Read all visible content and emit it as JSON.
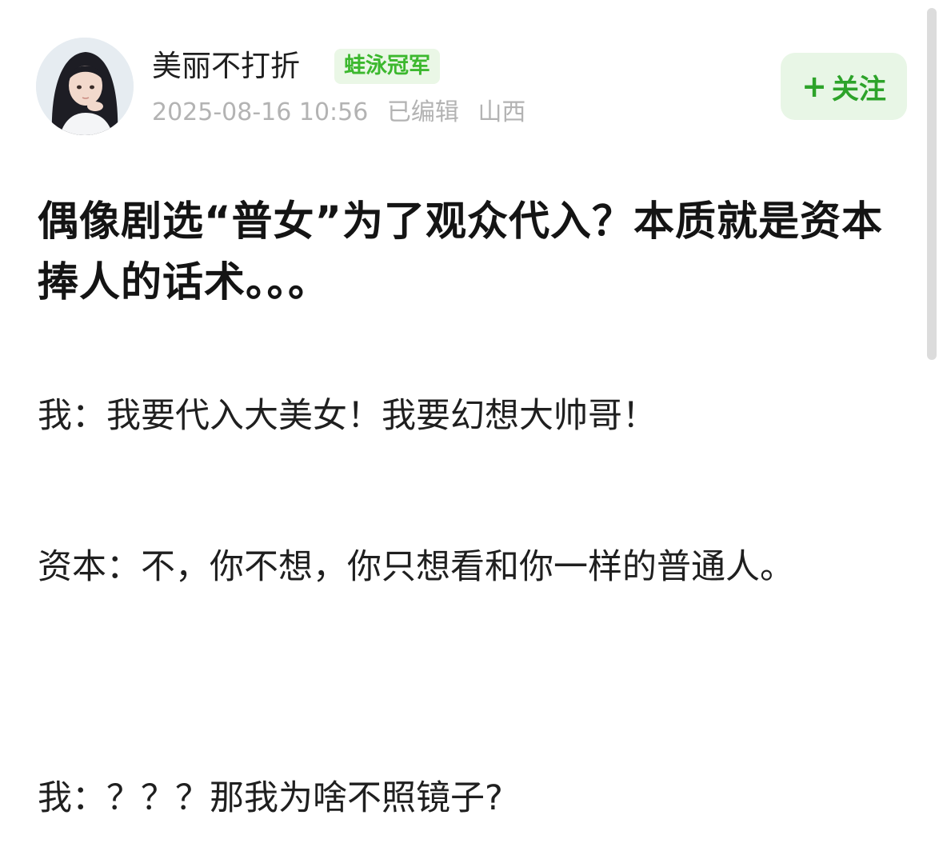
{
  "post": {
    "author": {
      "name": "美丽不打折",
      "badge": "蛙泳冠军",
      "avatar_icon": "avatar-girl-illustration"
    },
    "meta": {
      "datetime": "2025-08-16 10:56",
      "edited": "已编辑",
      "location": "山西"
    },
    "follow": {
      "plus": "+",
      "label": "关注"
    },
    "title": "偶像剧选“普女”为了观众代入？本质就是资本捧人的话术。。。",
    "paragraphs": [
      "我：我要代入大美女！我要幻想大帅哥！",
      "资本：不，你不想，你只想看和你一样的普通人。",
      "我：？？？那我为啥不照镜子?"
    ]
  },
  "colors": {
    "accent_green": "#2da32a",
    "badge_bg": "#eaf7e6",
    "meta_gray": "#b3b3b3"
  }
}
